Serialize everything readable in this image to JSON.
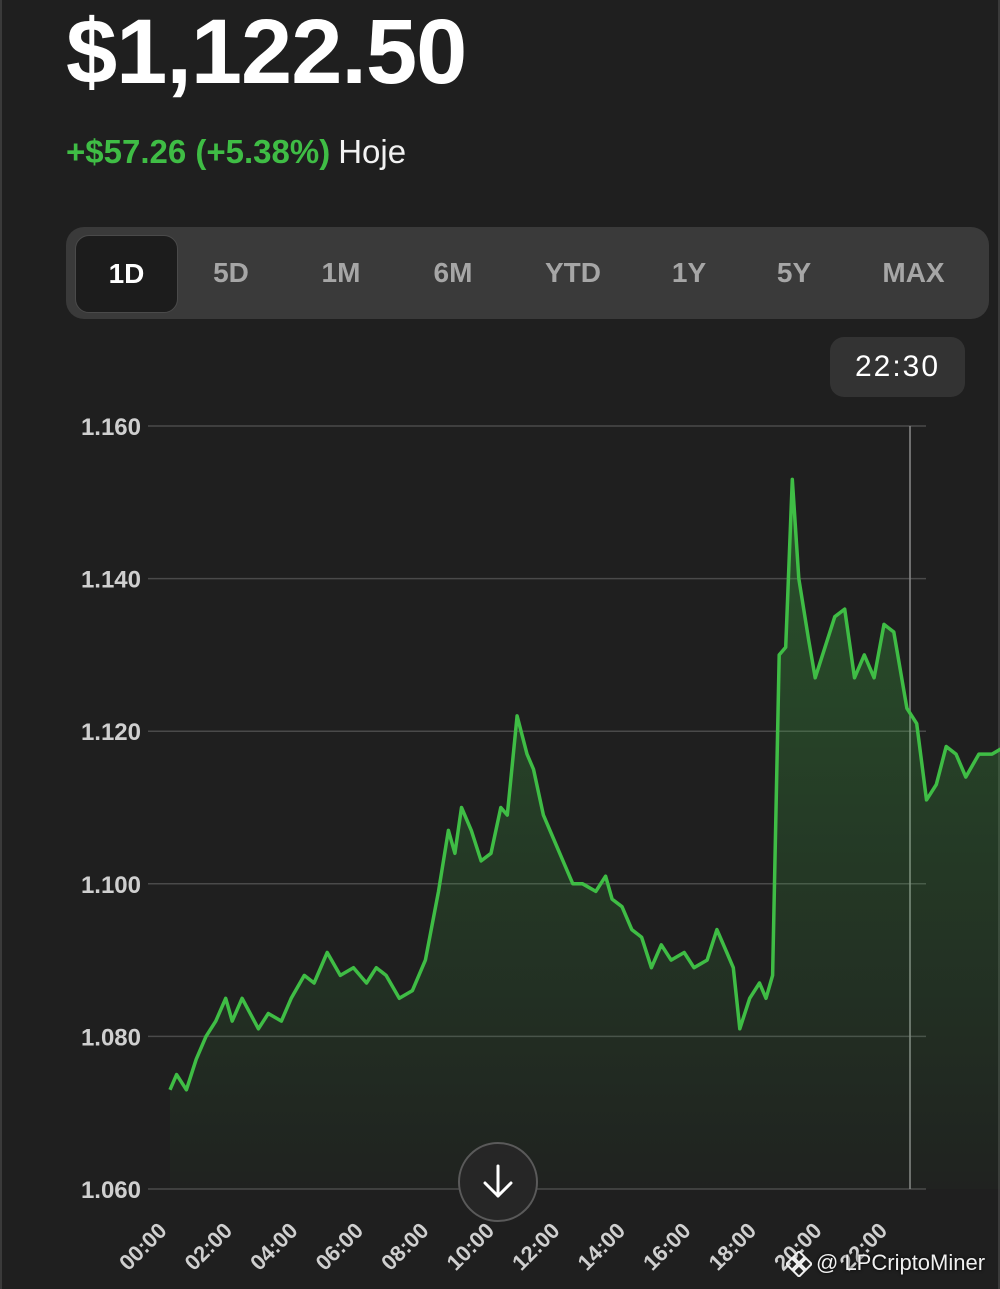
{
  "header": {
    "price": "$1,122.50",
    "change": "+$57.26 (+5.38%)",
    "period": "Hoje"
  },
  "ranges": [
    "1D",
    "5D",
    "1M",
    "6M",
    "YTD",
    "1Y",
    "5Y",
    "MAX"
  ],
  "active_range": "1D",
  "crosshair_time": "22:30",
  "watermark": "@ LPCriptoMiner",
  "colors": {
    "line": "#3fbd45",
    "background": "#1f1f1f",
    "grid": "#4a4a4a"
  },
  "chart_data": {
    "type": "area",
    "title": "",
    "xlabel": "",
    "ylabel": "",
    "ylim": [
      1.06,
      1.16
    ],
    "y_ticks": [
      "1.160",
      "1.140",
      "1.120",
      "1.100",
      "1.080",
      "1.060"
    ],
    "x_ticks": [
      "00:00",
      "02:00",
      "04:00",
      "06:00",
      "08:00",
      "10:00",
      "12:00",
      "14:00",
      "16:00",
      "18:00",
      "20:00",
      "22:00"
    ],
    "grid": true,
    "series": [
      {
        "values": [
          [
            0.0,
            1.073
          ],
          [
            0.1,
            1.075
          ],
          [
            0.25,
            1.073
          ],
          [
            0.4,
            1.077
          ],
          [
            0.55,
            1.08
          ],
          [
            0.7,
            1.082
          ],
          [
            0.85,
            1.085
          ],
          [
            0.95,
            1.082
          ],
          [
            1.1,
            1.085
          ],
          [
            1.35,
            1.081
          ],
          [
            1.5,
            1.083
          ],
          [
            1.7,
            1.082
          ],
          [
            1.85,
            1.085
          ],
          [
            2.05,
            1.088
          ],
          [
            2.2,
            1.087
          ],
          [
            2.4,
            1.091
          ],
          [
            2.6,
            1.088
          ],
          [
            2.8,
            1.089
          ],
          [
            3.0,
            1.087
          ],
          [
            3.15,
            1.089
          ],
          [
            3.3,
            1.088
          ],
          [
            3.5,
            1.085
          ],
          [
            3.7,
            1.086
          ],
          [
            3.9,
            1.09
          ],
          [
            4.1,
            1.099
          ],
          [
            4.25,
            1.107
          ],
          [
            4.35,
            1.104
          ],
          [
            4.45,
            1.11
          ],
          [
            4.6,
            1.107
          ],
          [
            4.75,
            1.103
          ],
          [
            4.9,
            1.104
          ],
          [
            5.05,
            1.11
          ],
          [
            5.15,
            1.109
          ],
          [
            5.3,
            1.122
          ],
          [
            5.45,
            1.117
          ],
          [
            5.55,
            1.115
          ],
          [
            5.7,
            1.109
          ],
          [
            5.85,
            1.106
          ],
          [
            6.0,
            1.103
          ],
          [
            6.15,
            1.1
          ],
          [
            6.3,
            1.1
          ],
          [
            6.5,
            1.099
          ],
          [
            6.65,
            1.101
          ],
          [
            6.75,
            1.098
          ],
          [
            6.9,
            1.097
          ],
          [
            7.05,
            1.094
          ],
          [
            7.2,
            1.093
          ],
          [
            7.35,
            1.089
          ],
          [
            7.5,
            1.092
          ],
          [
            7.65,
            1.09
          ],
          [
            7.85,
            1.091
          ],
          [
            8.0,
            1.089
          ],
          [
            8.2,
            1.09
          ],
          [
            8.35,
            1.094
          ],
          [
            8.5,
            1.091
          ],
          [
            8.6,
            1.089
          ],
          [
            8.7,
            1.081
          ],
          [
            8.85,
            1.085
          ],
          [
            9.0,
            1.087
          ],
          [
            9.1,
            1.085
          ],
          [
            9.2,
            1.088
          ],
          [
            9.3,
            1.13
          ],
          [
            9.4,
            1.131
          ],
          [
            9.5,
            1.153
          ],
          [
            9.6,
            1.14
          ],
          [
            9.75,
            1.132
          ],
          [
            9.85,
            1.127
          ],
          [
            10.0,
            1.131
          ],
          [
            10.15,
            1.135
          ],
          [
            10.3,
            1.136
          ],
          [
            10.45,
            1.127
          ],
          [
            10.6,
            1.13
          ],
          [
            10.75,
            1.127
          ],
          [
            10.9,
            1.134
          ],
          [
            11.05,
            1.133
          ],
          [
            11.25,
            1.123
          ],
          [
            11.4,
            1.121
          ],
          [
            11.55,
            1.111
          ],
          [
            11.7,
            1.113
          ],
          [
            11.85,
            1.118
          ],
          [
            12.0,
            1.117
          ],
          [
            12.15,
            1.114
          ],
          [
            12.35,
            1.117
          ],
          [
            12.55,
            1.117
          ],
          [
            12.75,
            1.118
          ],
          [
            12.95,
            1.115
          ],
          [
            13.15,
            1.117
          ],
          [
            13.35,
            1.116
          ],
          [
            13.55,
            1.117
          ],
          [
            13.7,
            1.119
          ],
          [
            13.85,
            1.119
          ],
          [
            13.95,
            1.118
          ]
        ]
      }
    ]
  }
}
